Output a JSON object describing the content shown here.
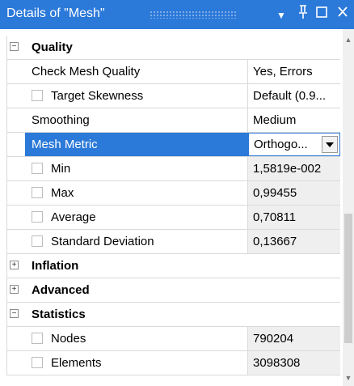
{
  "window": {
    "title": "Details of \"Mesh\"",
    "dropdown_icon": "▼",
    "pin_icon": "pin-icon",
    "maximize_icon": "maximize-icon",
    "close_icon": "close-icon"
  },
  "categories": {
    "quality": {
      "label": "Quality",
      "expander": "−"
    },
    "inflation": {
      "label": "Inflation",
      "expander": "+"
    },
    "advanced": {
      "label": "Advanced",
      "expander": "+"
    },
    "statistics": {
      "label": "Statistics",
      "expander": "−"
    }
  },
  "quality": {
    "check_mesh_quality": {
      "label": "Check Mesh Quality",
      "value": "Yes, Errors"
    },
    "target_skewness": {
      "label": "Target Skewness",
      "value": "Default (0.9..."
    },
    "smoothing": {
      "label": "Smoothing",
      "value": "Medium"
    },
    "mesh_metric": {
      "label": "Mesh Metric",
      "value": "Orthogo..."
    },
    "min": {
      "label": "Min",
      "value": "1,5819e-002"
    },
    "max": {
      "label": "Max",
      "value": "0,99455"
    },
    "average": {
      "label": "Average",
      "value": "0,70811"
    },
    "std_dev": {
      "label": "Standard Deviation",
      "value": "0,13667"
    }
  },
  "statistics": {
    "nodes": {
      "label": "Nodes",
      "value": "790204"
    },
    "elements": {
      "label": "Elements",
      "value": "3098308"
    }
  },
  "colors": {
    "accent": "#2b79d9",
    "readonly_bg": "#efefef"
  }
}
